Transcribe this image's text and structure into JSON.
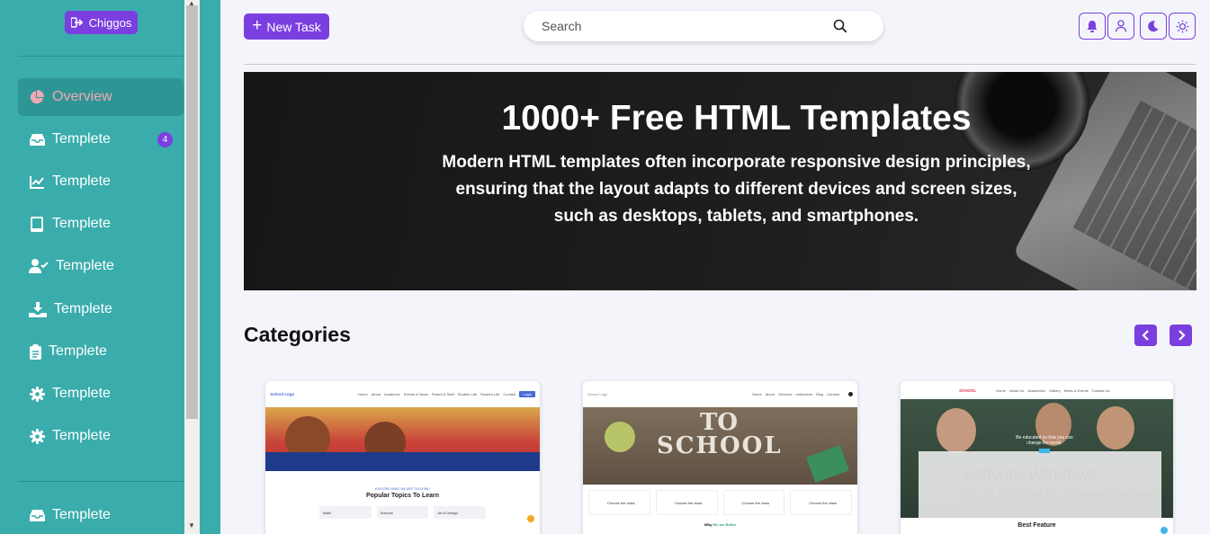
{
  "sidebar": {
    "brand_label": "Chiggos",
    "items": [
      {
        "label": "Overview",
        "icon": "pie-chart-icon"
      },
      {
        "label": "Templete",
        "icon": "inbox-icon",
        "badge": "4"
      },
      {
        "label": "Templete",
        "icon": "line-chart-icon"
      },
      {
        "label": "Templete",
        "icon": "tablet-icon"
      },
      {
        "label": "Templete",
        "icon": "user-check-icon"
      },
      {
        "label": "Templete",
        "icon": "hand-holding-icon"
      },
      {
        "label": "Templete",
        "icon": "clipboard-icon"
      },
      {
        "label": "Templete",
        "icon": "gear-icon"
      },
      {
        "label": "Templete",
        "icon": "gear-icon"
      },
      {
        "label": "Templete",
        "icon": "inbox-icon"
      }
    ]
  },
  "topbar": {
    "new_task_label": "New Task",
    "search_placeholder": "Search",
    "icons": [
      "bell-icon",
      "user-icon",
      "moon-icon",
      "sun-icon"
    ]
  },
  "hero": {
    "title": "1000+ Free HTML Templates",
    "lines": [
      "Modern HTML templates often incorporate responsive design principles,",
      "ensuring that the layout adapts to different devices and screen sizes,",
      "such as desktops, tablets, and smartphones."
    ]
  },
  "categories": {
    "title": "Categories",
    "cards": [
      {
        "logo": "School Logo",
        "nav": [
          "Home",
          "About",
          "Academic",
          "Events & News",
          "Parent & Staff",
          "Student Life",
          "Student Life",
          "Contact"
        ],
        "button": "Login",
        "kicker": "EXPLORE WHAT WE ARE TEACHING",
        "heading": "Popular Topics To Learn",
        "pills": [
          "Math",
          "Science",
          "Art & Design"
        ],
        "pill_sub": "Maths, Geometry and Mechanic",
        "pill_sub2": "Science",
        "pill_sub3": "Drawing"
      },
      {
        "logo": "School Logo",
        "nav": [
          "Home",
          "About",
          "Services",
          "Instructors",
          "Blog",
          "Contact"
        ],
        "hero_text_1": "TO",
        "hero_text_2": "SCHOOL",
        "feature_label": "Choose the class",
        "footer_1": "Why",
        "footer_2": "We are Better"
      },
      {
        "logo": "SCHOOL",
        "nav": [
          "Home",
          "About Us",
          "Academics",
          "Gallery",
          "News & Events",
          "Contact Us"
        ],
        "tagline_1": "Be educated so that you can",
        "tagline_2": "change the world.",
        "heading": "Best Feature"
      }
    ]
  },
  "watermark": {
    "line1": "Activate Windows",
    "line2": "Go to Settings to activate Windows."
  },
  "colors": {
    "sidebar": "#3aacac",
    "accent": "#7b3fe0",
    "active_text": "#f2a8b4",
    "page_bg": "#f4f5fb"
  }
}
